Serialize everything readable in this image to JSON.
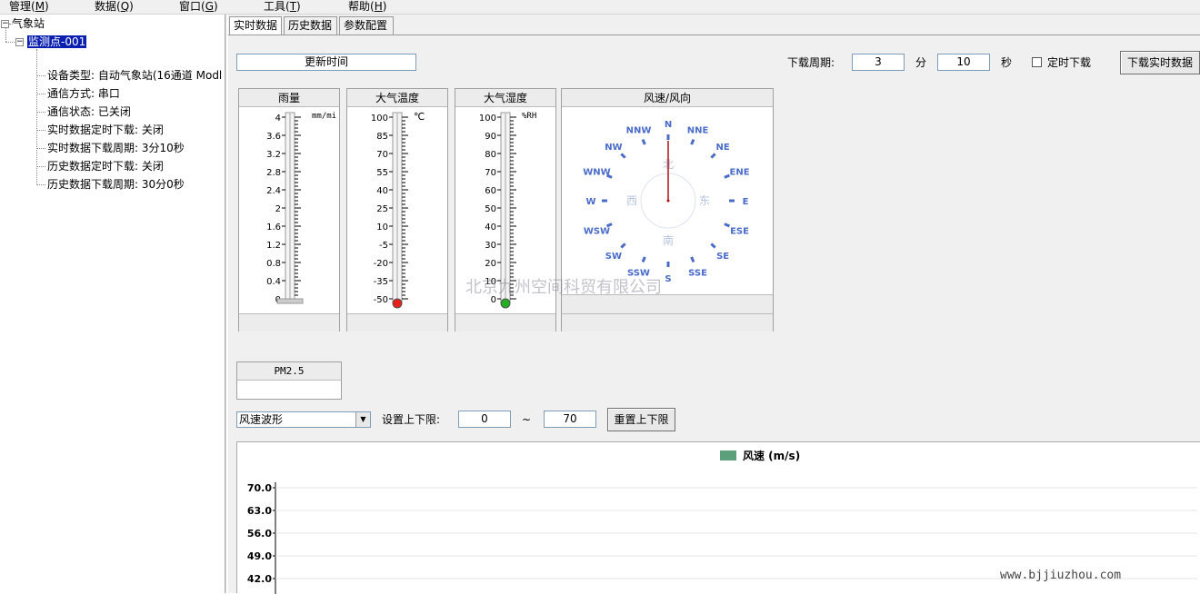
{
  "menu": [
    {
      "label": "管理(",
      "key": "M",
      "suffix": ")"
    },
    {
      "label": "数据(",
      "key": "Q",
      "suffix": ")"
    },
    {
      "label": "窗口(",
      "key": "G",
      "suffix": ")"
    },
    {
      "label": "工具(",
      "key": "T",
      "suffix": ")"
    },
    {
      "label": "帮助(",
      "key": "H",
      "suffix": ")"
    }
  ],
  "tree": {
    "root": "气象站",
    "node": "监测点-001",
    "children": [
      "设备类型: 自动气象站(16通道 Modl",
      "通信方式: 串口",
      "通信状态: 已关闭",
      "实时数据定时下载: 关闭",
      "实时数据下载周期: 3分10秒",
      "历史数据定时下载: 关闭",
      "历史数据下载周期: 30分0秒"
    ]
  },
  "tabs": [
    "实时数据",
    "历史数据",
    "参数配置"
  ],
  "toolbar": {
    "update_time_label": "更新时间",
    "period_label": "下载周期:",
    "minutes_value": "3",
    "minutes_unit": "分",
    "seconds_value": "10",
    "seconds_unit": "秒",
    "timed_download_label": "定时下载",
    "timed_download_checked": false,
    "download_button": "下载实时数据"
  },
  "gauges": {
    "rain": {
      "title": "雨量",
      "unit": "mm/mi",
      "ticks": [
        "4",
        "3.6",
        "3.2",
        "2.8",
        "2.4",
        "2",
        "1.6",
        "1.2",
        "0.8",
        "0.4",
        "0"
      ],
      "value": 0
    },
    "temperature": {
      "title": "大气温度",
      "unit": "℃",
      "ticks": [
        "100",
        "85",
        "70",
        "55",
        "40",
        "25",
        "10",
        "-5",
        "-20",
        "-35",
        "-50"
      ],
      "value": -50,
      "bulb_color": "#e8201a"
    },
    "humidity": {
      "title": "大气湿度",
      "unit": "%RH",
      "ticks": [
        "100",
        "90",
        "80",
        "70",
        "60",
        "50",
        "40",
        "30",
        "20",
        "10",
        "0"
      ],
      "value": 0,
      "bulb_color": "#22b022"
    },
    "wind": {
      "title": "风速/风向",
      "directions": [
        "N",
        "NNE",
        "NE",
        "ENE",
        "E",
        "ESE",
        "SE",
        "SSE",
        "S",
        "SSW",
        "SW",
        "WSW",
        "W",
        "WNW",
        "NW",
        "NNW"
      ],
      "cardinal_cn": {
        "north": "北",
        "east": "东",
        "south": "南",
        "west": "西"
      },
      "needle_direction": "N",
      "label_color": "#4a6cc8",
      "needle_color": "#b01010"
    }
  },
  "pm25": {
    "title": "PM2.5",
    "value": ""
  },
  "waveform": {
    "select_value": "风速波形",
    "limit_label": "设置上下限:",
    "lower": "0",
    "tilde": "~",
    "upper": "70",
    "reset_button": "重置上下限"
  },
  "watermark_center": "北京九州空间科贸有限公司",
  "watermark_corner": "www.bjjiuzhou.com",
  "chart_data": {
    "type": "line",
    "title": "",
    "series": [
      {
        "name": "风速 (m/s)",
        "values": [],
        "color": "#5ba07a"
      }
    ],
    "xlabel": "",
    "ylabel": "",
    "y_ticks": [
      "70.0",
      "63.0",
      "56.0",
      "49.0",
      "42.0"
    ],
    "ylim": [
      0,
      70
    ],
    "grid": true,
    "legend": "top-center"
  }
}
